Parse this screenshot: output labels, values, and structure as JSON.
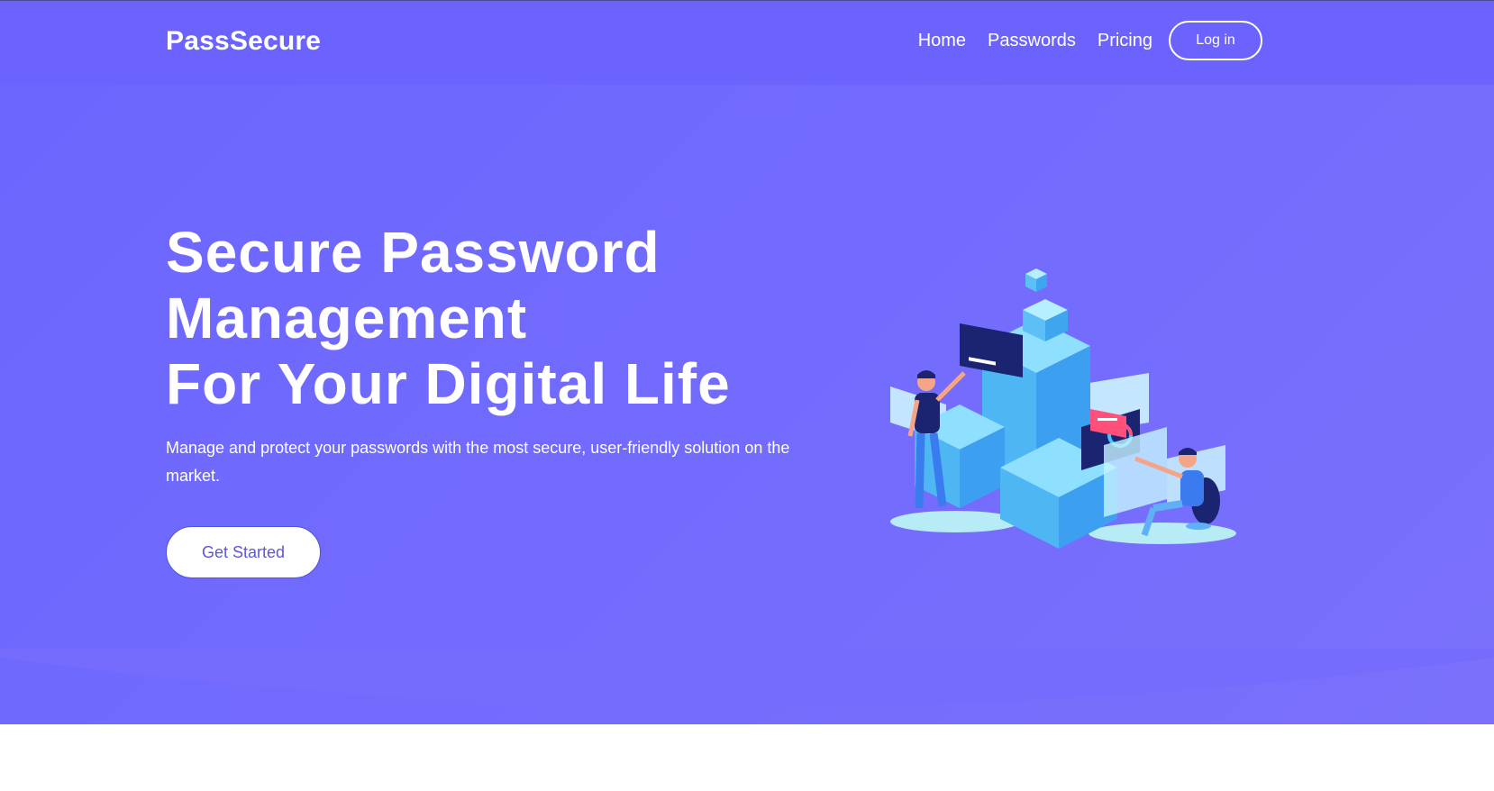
{
  "brand": {
    "name": "PassSecure"
  },
  "nav": {
    "links": [
      "Home",
      "Passwords",
      "Pricing"
    ],
    "login_label": "Log in"
  },
  "hero": {
    "title_lines": [
      "Secure Password",
      "Management",
      "For Your Digital Life"
    ],
    "subtitle": "Manage and protect your passwords with the most secure, user-friendly solution on the market.",
    "cta_label": "Get Started"
  },
  "colors": {
    "navbar": "#6c63fe",
    "hero_gradient_start": "#6c66fe",
    "hero_gradient_end": "#7a70fb",
    "page_background": "#ffffff",
    "cta_text": "#5b58d6"
  },
  "icons": {
    "illustration": "isometric-data-security-illustration-icon"
  }
}
